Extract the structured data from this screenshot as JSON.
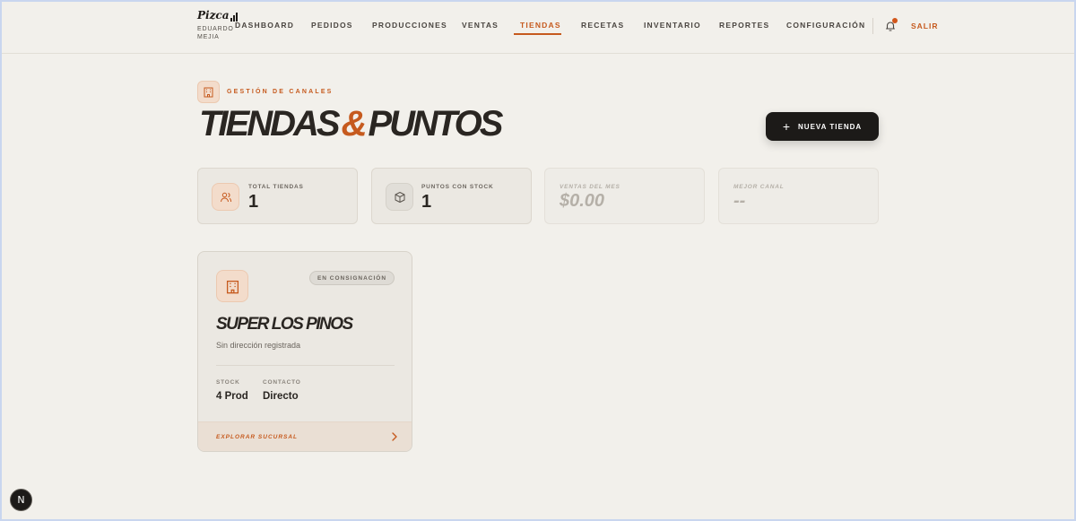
{
  "brand": {
    "logo_text": "Pizca",
    "user_name": "EDUARDO MEJIA"
  },
  "nav": {
    "items": [
      {
        "label": "DASHBOARD"
      },
      {
        "label": "PEDIDOS"
      },
      {
        "label": "PRODUCCIONES"
      },
      {
        "label": "VENTAS"
      },
      {
        "label": "TIENDAS",
        "active": true
      },
      {
        "label": "RECETAS"
      },
      {
        "label": "INVENTARIO"
      },
      {
        "label": "REPORTES"
      },
      {
        "label": "CONFIGURACIÓN"
      }
    ],
    "logout_label": "SALIR",
    "bell_icon": "bell-icon",
    "notification_dot": true
  },
  "header": {
    "section_tag": "GESTIÓN DE CANALES",
    "title_part1": "TIENDAS",
    "title_amp": "&",
    "title_part2": "PUNTOS",
    "new_button_label": "NUEVA TIENDA"
  },
  "stats": [
    {
      "label": "TOTAL TIENDAS",
      "value": "1",
      "icon": "users-icon"
    },
    {
      "label": "PUNTOS CON STOCK",
      "value": "1",
      "icon": "box-icon"
    },
    {
      "label": "VENTAS DEL MES",
      "value": "$0.00"
    },
    {
      "label": "MEJOR CANAL",
      "value": "--"
    }
  ],
  "store": {
    "badge": "EN CONSIGNACIÓN",
    "name": "SUPER LOS PINOS",
    "address": "Sin dirección registrada",
    "stock_label": "STOCK",
    "stock_value": "4 Prod",
    "contact_label": "CONTACTO",
    "contact_value": "Directo",
    "explore_label": "EXPLORAR SUCURSAL"
  },
  "dev_badge": "N",
  "colors": {
    "accent": "#c65a1e",
    "dark": "#1c1a18",
    "background": "#f2f0eb"
  }
}
